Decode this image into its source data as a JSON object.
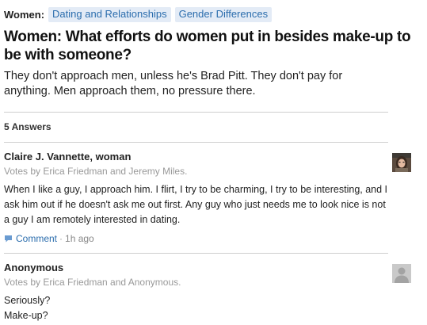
{
  "topics": {
    "label": "Women:",
    "tags": [
      "Dating and Relationships",
      "Gender Differences"
    ]
  },
  "question": {
    "title": "Women: What efforts do women put in besides make-up to be with someone?",
    "details": "They don't approach men, unless he's Brad Pitt. They don't pay for anything. Men approach them, no pressure there."
  },
  "answers_header": "5 Answers",
  "answers": [
    {
      "author": "Claire J. Vannette, woman",
      "votes": "Votes by Erica Friedman and Jeremy Miles.",
      "body": "When I like a guy, I approach him. I flirt, I try to be charming, I try to be interesting, and I ask him out if he doesn't ask me out first. Any guy who just needs me to look nice is not a guy I am remotely interested in dating.",
      "comment_label": "Comment",
      "separator": "·",
      "time": "1h ago"
    },
    {
      "author": "Anonymous",
      "votes": "Votes by Erica Friedman and Anonymous.",
      "body_lines": [
        "Seriously?",
        "Make-up?"
      ]
    }
  ],
  "colors": {
    "link": "#2b6dad",
    "tag_bg": "#e3ebf6",
    "divider": "#cfcfcf",
    "muted": "#999999"
  }
}
